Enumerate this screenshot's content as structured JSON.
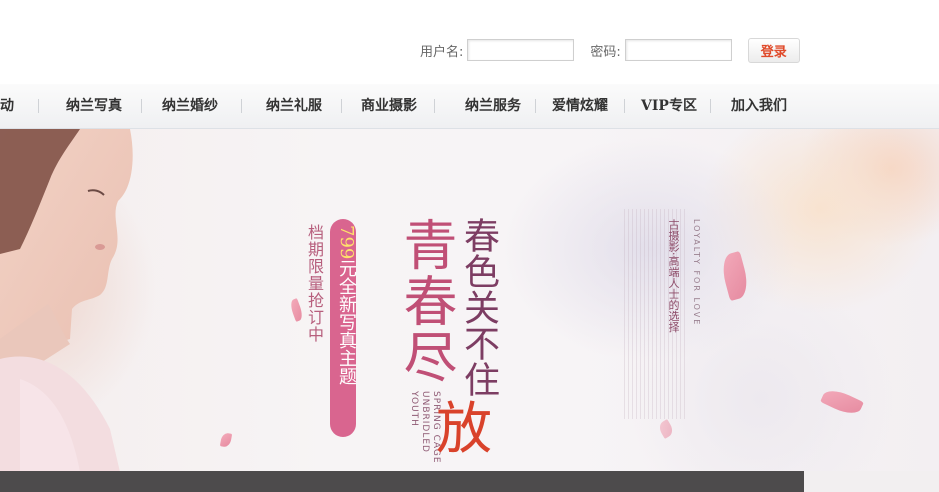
{
  "login": {
    "username_label": "用户名:",
    "password_label": "密码:",
    "username_value": "",
    "password_value": "",
    "login_button": "登录"
  },
  "nav": {
    "items": [
      {
        "label": "活动"
      },
      {
        "label": "纳兰写真"
      },
      {
        "label": "纳兰婚纱"
      },
      {
        "label": "纳兰礼服"
      },
      {
        "label": "商业摄影"
      },
      {
        "label": "纳兰服务"
      },
      {
        "label": "爱情炫耀"
      },
      {
        "label": "VIP专区"
      },
      {
        "label": "加入我们"
      }
    ]
  },
  "banner": {
    "badge_number": "799",
    "badge_text": "元全新写真主题",
    "promo_text": "档期限量抢订中",
    "title_main": "青春尽",
    "title_side": "春色关不住",
    "title_red": "放",
    "slogan": "古摄影·高端人士的选择",
    "eng_left": "SPRING CAGE UNBRIDLED YOUTH",
    "eng_right": "LOYALTY FOR LOVE"
  },
  "colors": {
    "accent_pink": "#d9658f",
    "title_pink": "#c04f76",
    "login_text": "#e04a2a",
    "nav_text": "#333333"
  }
}
